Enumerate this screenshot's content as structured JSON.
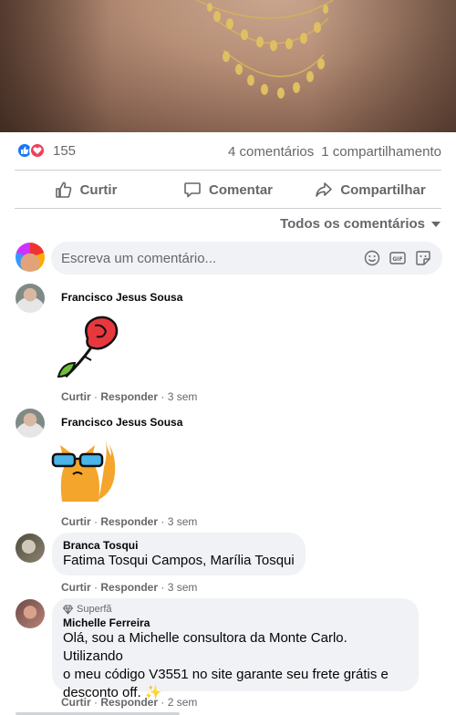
{
  "post": {
    "reaction_count": "155",
    "comments_count": "4 comentários",
    "shares_count": "1 compartilhamento"
  },
  "actions": {
    "like": "Curtir",
    "comment": "Comentar",
    "share": "Compartilhar"
  },
  "comments_filter": "Todos os comentários",
  "composer": {
    "placeholder": "Escreva um comentário...",
    "icons": [
      "emoji-icon",
      "gif-icon",
      "sticker-icon"
    ]
  },
  "comments": [
    {
      "author": "Francisco Jesus Sousa",
      "content_type": "sticker",
      "sticker": "rose",
      "like": "Curtir",
      "reply": "Responder",
      "time": "3 sem"
    },
    {
      "author": "Francisco Jesus Sousa",
      "content_type": "sticker",
      "sticker": "cool-fox",
      "like": "Curtir",
      "reply": "Responder",
      "time": "3 sem"
    },
    {
      "author": "Branca Tosqui",
      "text": "Fatima Tosqui Campos, Marília Tosqui",
      "like": "Curtir",
      "reply": "Responder",
      "time": "3 sem"
    },
    {
      "badge": "Superfã",
      "author": "Michelle Ferreira",
      "text_lines": [
        "Olá, sou a Michelle consultora da Monte Carlo. Utilizando",
        "o meu código V3551 no site garante seu frete grátis e",
        "desconto off. ✨"
      ],
      "like": "Curtir",
      "reply": "Responder",
      "time": "2 sem"
    }
  ],
  "colors": {
    "accent": "#1877f2",
    "love": "#f33e58",
    "muted": "#65676b",
    "bubble": "#f0f2f5"
  }
}
